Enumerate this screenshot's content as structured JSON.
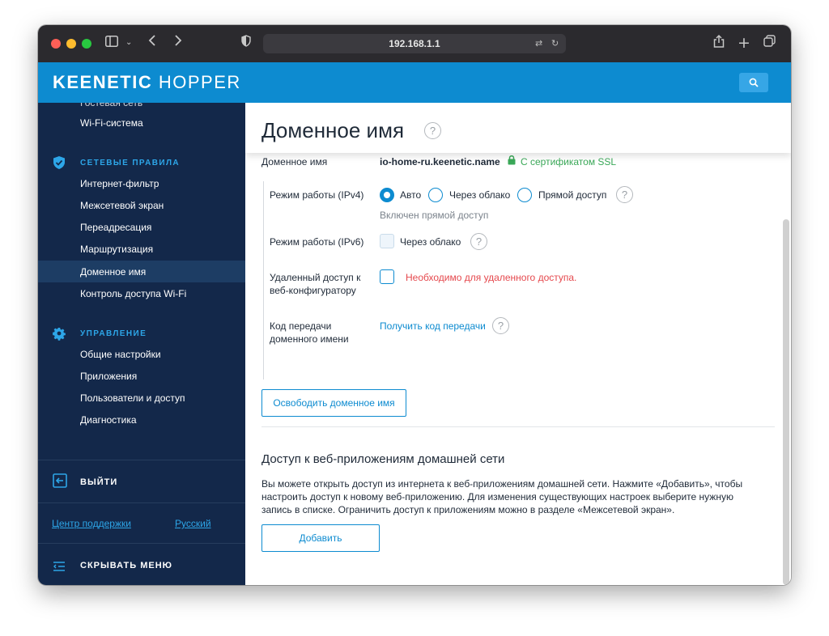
{
  "browser": {
    "url": "192.168.1.1"
  },
  "header": {
    "logo_bold": "KEENETIC",
    "logo_light": "HOPPER",
    "brand_color": "#0d8bd0"
  },
  "sidebar": {
    "clipped_item": "Гостевая сеть",
    "wifi_system": "Wi-Fi-система",
    "sections": [
      {
        "title": "СЕТЕВЫЕ ПРАВИЛА",
        "icon": "shield-icon",
        "items": [
          "Интернет-фильтр",
          "Межсетевой экран",
          "Переадресация",
          "Маршрутизация",
          "Доменное имя",
          "Контроль доступа Wi-Fi"
        ]
      },
      {
        "title": "УПРАВЛЕНИЕ",
        "icon": "gear-icon",
        "items": [
          "Общие настройки",
          "Приложения",
          "Пользователи и доступ",
          "Диагностика"
        ]
      }
    ],
    "active_item": "Доменное имя",
    "logout": "ВЫЙТИ",
    "support_link": "Центр поддержки",
    "language_link": "Русский",
    "hide_menu": "СКРЫВАТЬ МЕНЮ"
  },
  "main": {
    "title": "Доменное имя",
    "help_glyph": "?",
    "domain_label": "Доменное имя",
    "domain_value": "io-home-ru.keenetic.name",
    "ssl_text": "С сертификатом SSL",
    "ssl_color": "#3aa858",
    "ipv4_label": "Режим работы (IPv4)",
    "ipv4_options": [
      "Авто",
      "Через облако",
      "Прямой доступ"
    ],
    "ipv4_selected": "Авто",
    "ipv4_status": "Включен прямой доступ",
    "ipv6_label": "Режим работы (IPv6)",
    "ipv6_option": "Через облако",
    "remote_label_1": "Удаленный доступ к",
    "remote_label_2": "веб-конфигуратору",
    "remote_warning": "Необходимо для удаленного доступа.",
    "warning_color": "#e5484d",
    "transfer_label_1": "Код передачи",
    "transfer_label_2": "доменного имени",
    "transfer_link": "Получить код передачи",
    "release_button": "Освободить доменное имя",
    "webapps_title": "Доступ к веб-приложениям домашней сети",
    "webapps_text": "Вы можете открыть доступ из интернета к веб-приложениям домашней сети. Нажмите «Добавить», чтобы настроить доступ к новому веб-приложению. Для изменения существующих настроек выберите нужную запись в списке. Ограничить доступ к приложениям можно в разделе «Межсетевой экран».",
    "add_button": "Добавить"
  }
}
